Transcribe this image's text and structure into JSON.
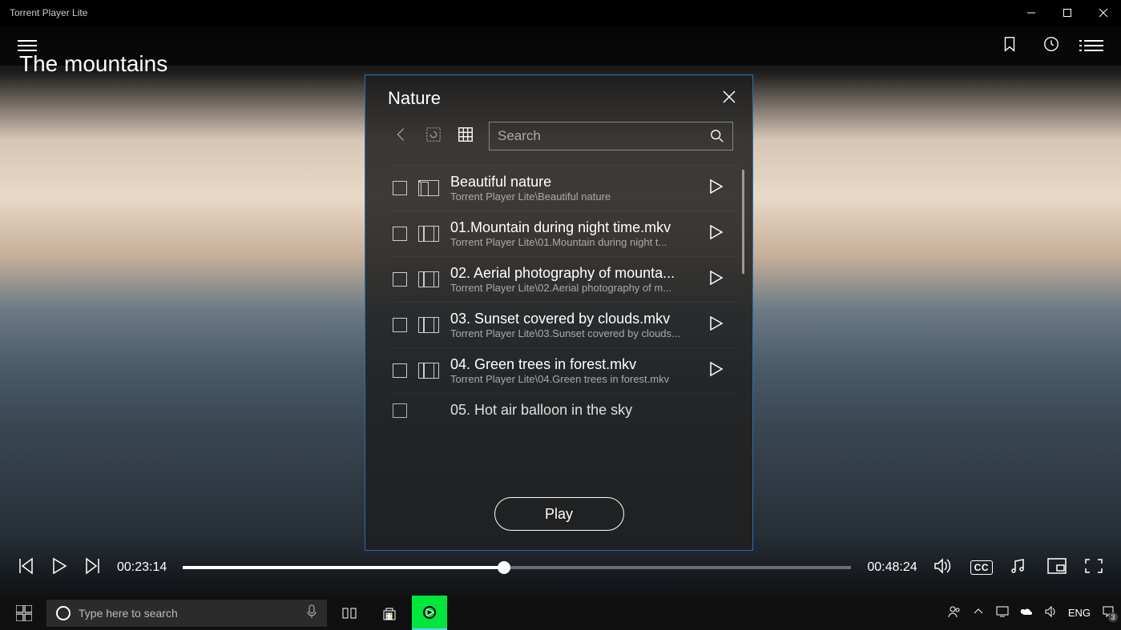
{
  "window": {
    "title": "Torrent Player Lite"
  },
  "video": {
    "title": "The mountains",
    "current_time": "00:23:14",
    "duration": "00:48:24"
  },
  "playlist": {
    "title": "Nature",
    "search_placeholder": "Search",
    "play_label": "Play",
    "items": [
      {
        "type": "folder",
        "title": "Beautiful nature",
        "sub": "Torrent Player Lite\\Beautiful nature"
      },
      {
        "type": "media",
        "title": "01.Mountain during night time.mkv",
        "sub": "Torrent Player Lite\\01.Mountain during night t..."
      },
      {
        "type": "media",
        "title": "02. Aerial photography of mounta...",
        "sub": "Torrent Player Lite\\02.Aerial photography of m..."
      },
      {
        "type": "media",
        "title": "03. Sunset covered by clouds.mkv",
        "sub": "Torrent Player Lite\\03.Sunset covered by clouds..."
      },
      {
        "type": "media",
        "title": "04. Green trees in forest.mkv",
        "sub": "Torrent Player Lite\\04.Green trees in forest.mkv"
      },
      {
        "type": "media",
        "title": "05. Hot air balloon in the sky",
        "sub": ""
      }
    ]
  },
  "taskbar": {
    "search_placeholder": "Type here to search",
    "lang": "ENG"
  }
}
